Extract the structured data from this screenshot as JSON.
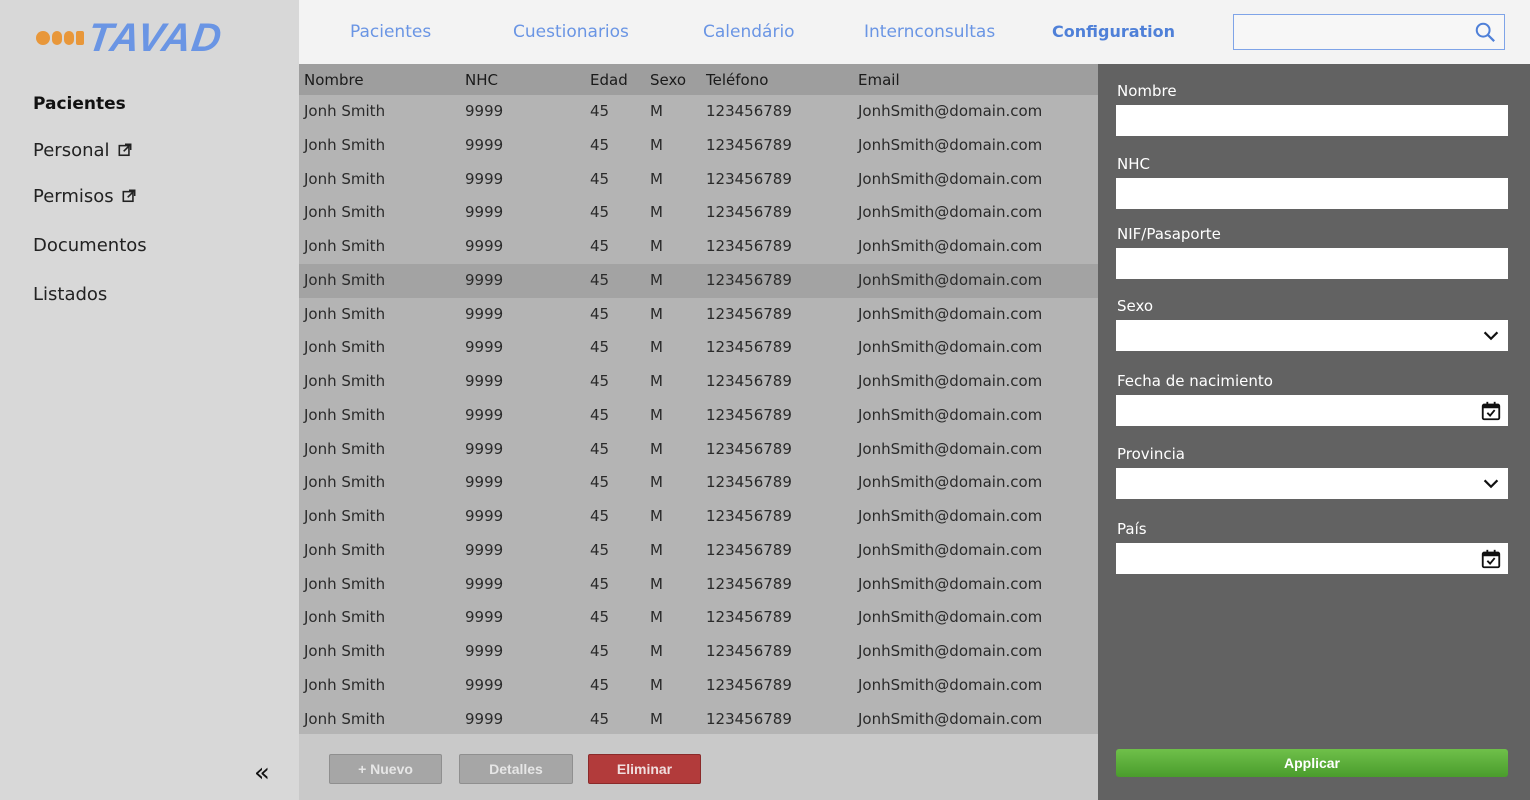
{
  "app": {
    "logo_text": "TAVAD"
  },
  "sidebar": {
    "items": [
      {
        "label": "Pacientes"
      },
      {
        "label": "Personal"
      },
      {
        "label": "Permisos"
      },
      {
        "label": "Documentos"
      },
      {
        "label": "Listados"
      }
    ],
    "collapse_label": "«"
  },
  "topnav": {
    "items": [
      {
        "label": "Pacientes"
      },
      {
        "label": "Cuestionarios"
      },
      {
        "label": "Calendário"
      },
      {
        "label": "Internconsultas"
      },
      {
        "label": "Configuration"
      }
    ],
    "active": "Configuration",
    "search": {
      "value": "",
      "placeholder": ""
    }
  },
  "table": {
    "columns": [
      "Nombre",
      "NHC",
      "Edad",
      "Sexo",
      "Teléfono",
      "Email"
    ],
    "selected_row": 5,
    "rows": [
      [
        "Jonh Smith",
        "9999",
        "45",
        "M",
        "123456789",
        "JonhSmith@domain.com"
      ],
      [
        "Jonh Smith",
        "9999",
        "45",
        "M",
        "123456789",
        "JonhSmith@domain.com"
      ],
      [
        "Jonh Smith",
        "9999",
        "45",
        "M",
        "123456789",
        "JonhSmith@domain.com"
      ],
      [
        "Jonh Smith",
        "9999",
        "45",
        "M",
        "123456789",
        "JonhSmith@domain.com"
      ],
      [
        "Jonh Smith",
        "9999",
        "45",
        "M",
        "123456789",
        "JonhSmith@domain.com"
      ],
      [
        "Jonh Smith",
        "9999",
        "45",
        "M",
        "123456789",
        "JonhSmith@domain.com"
      ],
      [
        "Jonh Smith",
        "9999",
        "45",
        "M",
        "123456789",
        "JonhSmith@domain.com"
      ],
      [
        "Jonh Smith",
        "9999",
        "45",
        "M",
        "123456789",
        "JonhSmith@domain.com"
      ],
      [
        "Jonh Smith",
        "9999",
        "45",
        "M",
        "123456789",
        "JonhSmith@domain.com"
      ],
      [
        "Jonh Smith",
        "9999",
        "45",
        "M",
        "123456789",
        "JonhSmith@domain.com"
      ],
      [
        "Jonh Smith",
        "9999",
        "45",
        "M",
        "123456789",
        "JonhSmith@domain.com"
      ],
      [
        "Jonh Smith",
        "9999",
        "45",
        "M",
        "123456789",
        "JonhSmith@domain.com"
      ],
      [
        "Jonh Smith",
        "9999",
        "45",
        "M",
        "123456789",
        "JonhSmith@domain.com"
      ],
      [
        "Jonh Smith",
        "9999",
        "45",
        "M",
        "123456789",
        "JonhSmith@domain.com"
      ],
      [
        "Jonh Smith",
        "9999",
        "45",
        "M",
        "123456789",
        "JonhSmith@domain.com"
      ],
      [
        "Jonh Smith",
        "9999",
        "45",
        "M",
        "123456789",
        "JonhSmith@domain.com"
      ],
      [
        "Jonh Smith",
        "9999",
        "45",
        "M",
        "123456789",
        "JonhSmith@domain.com"
      ],
      [
        "Jonh Smith",
        "9999",
        "45",
        "M",
        "123456789",
        "JonhSmith@domain.com"
      ],
      [
        "Jonh Smith",
        "9999",
        "45",
        "M",
        "123456789",
        "JonhSmith@domain.com"
      ]
    ]
  },
  "actions": {
    "new_label": "+ Nuevo",
    "details_label": "Detalles",
    "delete_label": "Eliminar"
  },
  "filters": {
    "nombre": {
      "label": "Nombre",
      "value": ""
    },
    "nhc": {
      "label": "NHC",
      "value": ""
    },
    "nif": {
      "label": "NIF/Pasaporte",
      "value": ""
    },
    "sexo": {
      "label": "Sexo",
      "value": ""
    },
    "fecha": {
      "label": "Fecha de nacimiento",
      "value": ""
    },
    "provincia": {
      "label": "Provincia",
      "value": ""
    },
    "pais": {
      "label": "País",
      "value": ""
    },
    "apply_label": "Applicar"
  },
  "colors": {
    "accent_blue": "#6a95e4",
    "logo_orange": "#e8973a",
    "delete_red": "#b23b3b",
    "apply_green": "#5cad3a",
    "panel_gray": "#626262"
  }
}
